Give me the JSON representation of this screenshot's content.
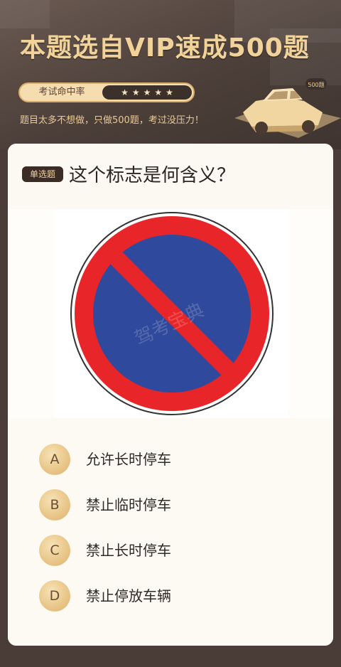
{
  "header": {
    "title": "本题选自VIP速成500题",
    "rating_label": "考试命中率",
    "stars": [
      "★",
      "★",
      "★",
      "★",
      "★"
    ],
    "subtitle": "题目太多不想做，只做500题，考过没压力！",
    "car_badge": "500题"
  },
  "question": {
    "type_badge": "单选题",
    "text": "这个标志是何含义？",
    "watermark": "驾考宝典"
  },
  "options": [
    {
      "letter": "A",
      "text": "允许长时停车"
    },
    {
      "letter": "B",
      "text": "禁止临时停车"
    },
    {
      "letter": "C",
      "text": "禁止长时停车"
    },
    {
      "letter": "D",
      "text": "禁止停放车辆"
    }
  ],
  "colors": {
    "background": "#4a3d38",
    "title_gold": "#f1d39a",
    "sign_red": "#e8262a",
    "sign_blue": "#2f4a9c",
    "option_gold": "#e8c587"
  }
}
